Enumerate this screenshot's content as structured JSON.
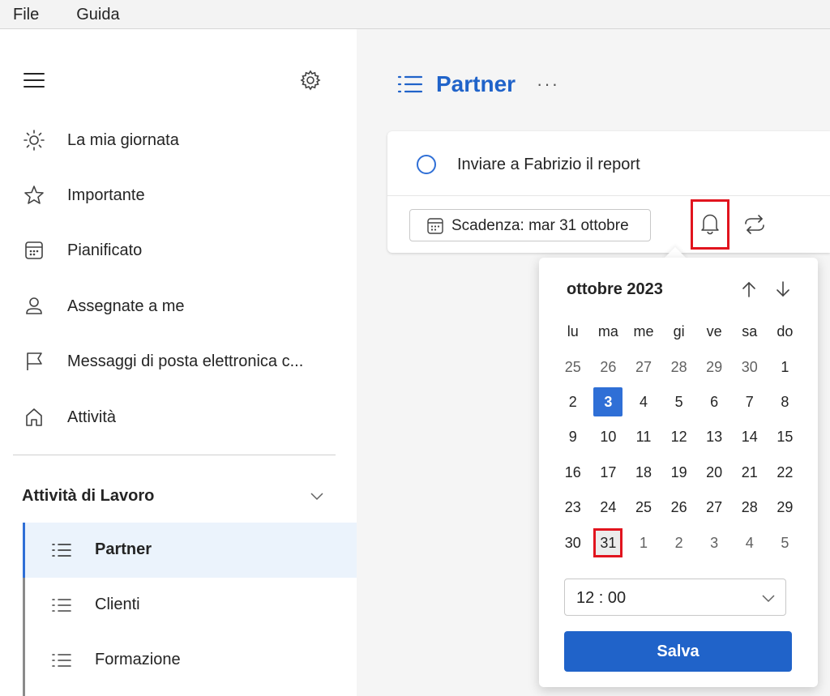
{
  "menubar": {
    "file": "File",
    "help": "Guida"
  },
  "sidebar": {
    "items": [
      {
        "label": "La mia giornata",
        "icon": "sun-icon"
      },
      {
        "label": "Importante",
        "icon": "star-icon"
      },
      {
        "label": "Pianificato",
        "icon": "calendar-icon"
      },
      {
        "label": "Assegnate a me",
        "icon": "person-icon"
      },
      {
        "label": "Messaggi di posta elettronica c...",
        "icon": "flag-icon"
      },
      {
        "label": "Attività",
        "icon": "home-icon"
      }
    ],
    "group": {
      "label": "Attività di Lavoro",
      "lists": [
        {
          "label": "Partner",
          "selected": true
        },
        {
          "label": "Clienti",
          "selected": false
        },
        {
          "label": "Formazione",
          "selected": false
        }
      ]
    }
  },
  "main": {
    "title": "Partner",
    "more": "···",
    "task": {
      "title": "Inviare a Fabrizio il report",
      "due_label": "Scadenza: mar 31 ottobre"
    }
  },
  "datepicker": {
    "month_title": "ottobre 2023",
    "weekdays": [
      "lu",
      "ma",
      "me",
      "gi",
      "ve",
      "sa",
      "do"
    ],
    "weeks": [
      [
        "25",
        "26",
        "27",
        "28",
        "29",
        "30",
        "1"
      ],
      [
        "2",
        "3",
        "4",
        "5",
        "6",
        "7",
        "8"
      ],
      [
        "9",
        "10",
        "11",
        "12",
        "13",
        "14",
        "15"
      ],
      [
        "16",
        "17",
        "18",
        "19",
        "20",
        "21",
        "22"
      ],
      [
        "23",
        "24",
        "25",
        "26",
        "27",
        "28",
        "29"
      ],
      [
        "30",
        "31",
        "1",
        "2",
        "3",
        "4",
        "5"
      ]
    ],
    "today": "3",
    "selected": "31",
    "time": "12 : 00",
    "save_label": "Salva"
  },
  "colors": {
    "accent": "#2063c9",
    "highlight": "#e1141e"
  }
}
